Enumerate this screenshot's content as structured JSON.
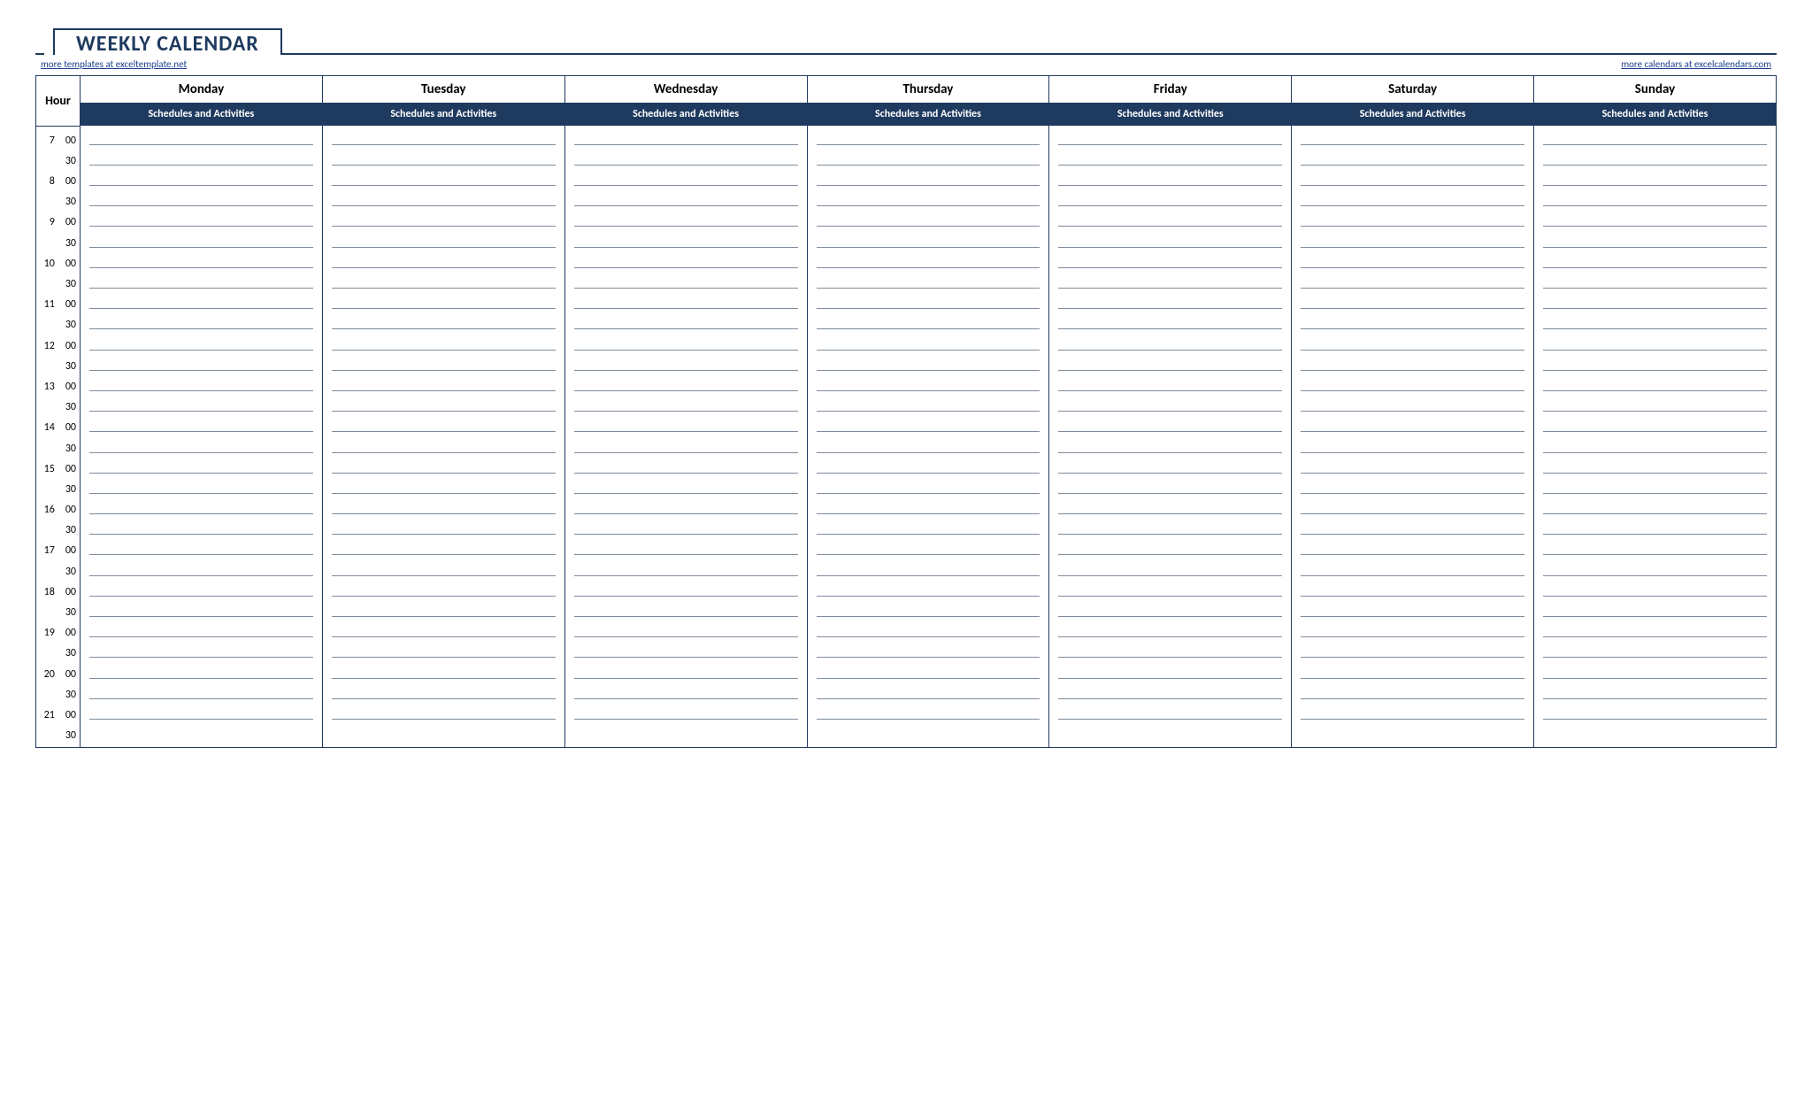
{
  "title": "WEEKLY CALENDAR",
  "links": {
    "left": "more templates at exceltemplate.net",
    "right": "more calendars at excelcalendars.com"
  },
  "hour_label": "Hour",
  "subheader": "Schedules and Activities",
  "days": [
    "Monday",
    "Tuesday",
    "Wednesday",
    "Thursday",
    "Friday",
    "Saturday",
    "Sunday"
  ],
  "hours": [
    7,
    8,
    9,
    10,
    11,
    12,
    13,
    14,
    15,
    16,
    17,
    18,
    19,
    20,
    21
  ],
  "minute_labels": [
    "00",
    "30"
  ]
}
